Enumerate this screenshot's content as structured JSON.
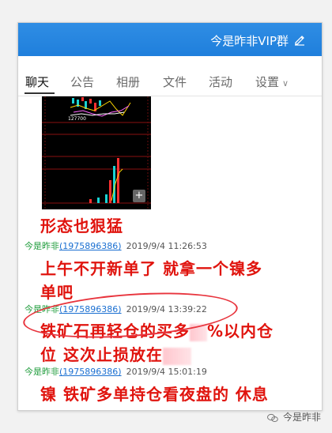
{
  "window": {
    "title": "今是昨非VIP群",
    "icon_edit": "edit-icon"
  },
  "tabs": [
    {
      "label": "聊天"
    },
    {
      "label": "公告"
    },
    {
      "label": "相册"
    },
    {
      "label": "文件"
    },
    {
      "label": "活动"
    },
    {
      "label": "设置"
    }
  ],
  "chart_image": {
    "price_label": "127700",
    "zoom_icon": "plus-magnifier-icon"
  },
  "messages": [
    {
      "text": "形态也狠猛"
    },
    {
      "sender": "今是昨非",
      "uid": "(1975896386)",
      "time": "2019/9/4 11:26:53",
      "text_line1": "上午不开新单了 就拿一个镍多",
      "text_line2": "单吧"
    },
    {
      "sender": "今是昨非",
      "uid": "(1975896386)",
      "time": "2019/9/4 13:39:22",
      "text_line1a": "铁矿石再轻仓的买多",
      "text_line1b": "%以内仓",
      "text_line2a": "位 这次止损放在"
    },
    {
      "sender": "今是昨非",
      "uid": "(1975896386)",
      "time": "2019/9/4 15:01:19",
      "text_line1": "镍 铁矿多单持仓看夜盘的 休息"
    }
  ],
  "watermark": {
    "text": "今是昨非",
    "icon": "wechat-channel-icon"
  },
  "colors": {
    "titlebar": "#1f7fdc",
    "message_red": "#e0140e",
    "sender_green": "#1d9b3a",
    "uid_blue": "#1a6fd1"
  }
}
